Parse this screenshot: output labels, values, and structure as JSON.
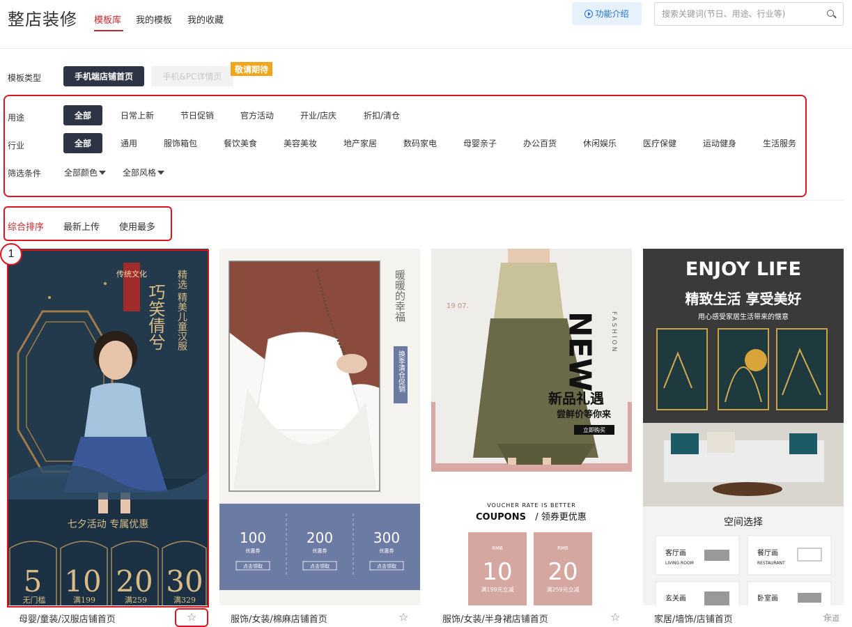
{
  "header": {
    "app_title": "整店装修",
    "tabs": [
      "模板库",
      "我的模板",
      "我的收藏"
    ],
    "intro_button": "功能介绍",
    "search_placeholder": "搜索关键词(节日、用途、行业等)"
  },
  "template_type": {
    "label": "模板类型",
    "options": [
      "手机端店铺首页",
      "手机&PC详情页"
    ],
    "badge": "敬请期待"
  },
  "filters": {
    "usage_label": "用途",
    "usage": [
      "全部",
      "日常上新",
      "节日促销",
      "官方活动",
      "开业/店庆",
      "折扣/清仓"
    ],
    "industry_label": "行业",
    "industry": [
      "全部",
      "通用",
      "服饰箱包",
      "餐饮美食",
      "美容美妆",
      "地产家居",
      "数码家电",
      "母婴亲子",
      "办公百货",
      "休闲娱乐",
      "医疗保健",
      "运动健身",
      "生活服务"
    ],
    "condition_label": "筛选条件",
    "color_dropdown": "全部颜色",
    "style_dropdown": "全部风格"
  },
  "sort": [
    "综合排序",
    "最新上传",
    "使用最多"
  ],
  "annotation_number": "1",
  "cards": [
    {
      "title": "母婴/童装/汉服店铺首页",
      "img": {
        "seal": "传统文化",
        "headline": "巧笑倩兮",
        "vertical": "精选 精美儿童汉服",
        "event": "七夕活动 专属优惠",
        "coupons": [
          {
            "value": "5",
            "note": "无门槛"
          },
          {
            "value": "10",
            "note": "满199"
          },
          {
            "value": "20",
            "note": "满259"
          },
          {
            "value": "30",
            "note": "满329"
          }
        ]
      }
    },
    {
      "title": "服饰/女装/棉麻店铺首页",
      "img": {
        "poem": "暖暖的幸福",
        "tag": "换季清仓促销",
        "coupons": [
          "100",
          "200",
          "300"
        ],
        "coupon_small": "优惠券",
        "coupon_btn": "点击领取"
      }
    },
    {
      "title": "服饰/女装/半身裙店铺首页",
      "img": {
        "date": "19 07.",
        "new": "NEW",
        "fashion": "FASHION",
        "headline": "新品礼遇",
        "sub": "尝鲜价等你来",
        "buy": "立即购买",
        "voucher_top": "VOUCHER RATE IS BETTER",
        "voucher_bold": "COUPONS",
        "voucher_cn": "/ 领券更优惠",
        "coupons": [
          {
            "cur": "RMB",
            "value": "10",
            "note": "满199元立减"
          },
          {
            "cur": "RMB",
            "value": "20",
            "note": "满259元立减"
          }
        ]
      }
    },
    {
      "title": "家居/墙饰/店铺首页",
      "img": {
        "enjoy": "ENJOY LIFE",
        "headline": "精致生活 享受美好",
        "sub": "用心感受家居生活带来的惬意",
        "section": "空间选择",
        "rooms": [
          {
            "cn": "客厅画",
            "en": "LIVING ROOM"
          },
          {
            "cn": "餐厅画",
            "en": "RESTAURANT"
          },
          {
            "cn": "玄关画",
            "en": ""
          },
          {
            "cn": "卧室画",
            "en": ""
          }
        ]
      }
    }
  ],
  "watermark": "乐道"
}
